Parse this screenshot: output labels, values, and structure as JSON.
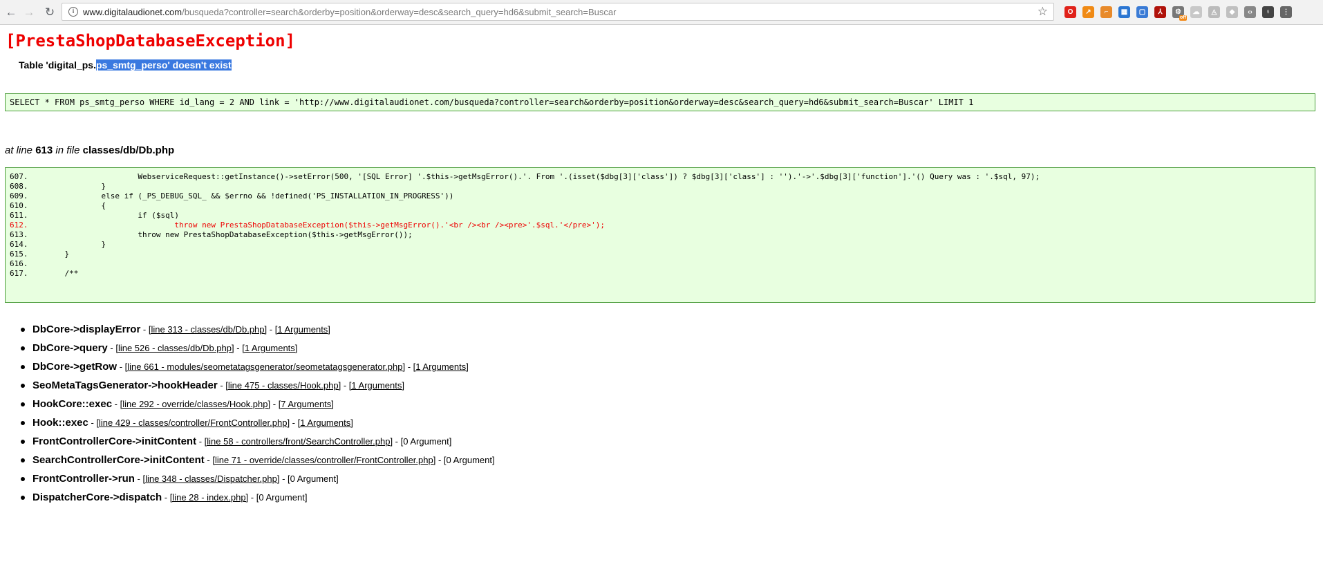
{
  "browser": {
    "url_host": "www.digitalaudionet.com",
    "url_path": "/busqueda?controller=search&orderby=position&orderway=desc&search_query=hd6&submit_search=Buscar",
    "back_icon": "arrow-left-icon",
    "forward_icon": "arrow-right-icon",
    "reload_icon": "reload-icon",
    "bookmark_icon": "star-icon",
    "extensions": [
      {
        "name": "opera-icon",
        "color": "#e0221a",
        "glyph": "O"
      },
      {
        "name": "chart-icon",
        "color": "#f08a14",
        "glyph": "↗"
      },
      {
        "name": "rss-icon",
        "color": "#e88a2a",
        "glyph": "⌐"
      },
      {
        "name": "calendar-icon",
        "color": "#2b76d2",
        "glyph": "▦"
      },
      {
        "name": "screen-icon",
        "color": "#3a7bd5",
        "glyph": "▢"
      },
      {
        "name": "pdf-icon",
        "color": "#b0120a",
        "glyph": "⅄"
      },
      {
        "name": "settings-off-icon",
        "color": "#777777",
        "glyph": "⚙",
        "badge": "off"
      },
      {
        "name": "cloud-icon",
        "color": "#c8c8c8",
        "glyph": "☁"
      },
      {
        "name": "drive-icon",
        "color": "#bbbbbb",
        "glyph": "◬"
      },
      {
        "name": "diamond-icon",
        "color": "#c0c0c0",
        "glyph": "◆"
      },
      {
        "name": "code-icon",
        "color": "#888888",
        "glyph": "‹›"
      },
      {
        "name": "lightbulb-icon",
        "color": "#444444",
        "glyph": "♀"
      },
      {
        "name": "menu-icon",
        "color": "#666666",
        "glyph": "⋮"
      }
    ]
  },
  "error": {
    "title": "[PrestaShopDatabaseException]",
    "message_prefix": "Table 'digital_ps.",
    "message_selected": "ps_smtg_perso' doesn't exist",
    "sql": "SELECT * FROM ps_smtg_perso WHERE id_lang = 2 AND link = 'http://www.digitalaudionet.com/busqueda?controller=search&orderby=position&orderway=desc&search_query=hd6&submit_search=Buscar' LIMIT 1",
    "at_line_prefix": "at line",
    "line": "613",
    "in_file_text": "in file",
    "file": "classes/db/Db.php"
  },
  "code": [
    {
      "num": "607.",
      "text": "                    WebserviceRequest::getInstance()->setError(500, '[SQL Error] '.$this->getMsgError().'. From '.(isset($dbg[3]['class']) ? $dbg[3]['class'] : '').'->'.$dbg[3]['function'].'() Query was : '.$sql, 97);",
      "highlight": false
    },
    {
      "num": "608.",
      "text": "            }",
      "highlight": false
    },
    {
      "num": "609.",
      "text": "            else if (_PS_DEBUG_SQL_ && $errno && !defined('PS_INSTALLATION_IN_PROGRESS'))",
      "highlight": false
    },
    {
      "num": "610.",
      "text": "            {",
      "highlight": false
    },
    {
      "num": "611.",
      "text": "                    if ($sql)",
      "highlight": false
    },
    {
      "num": "612.",
      "text": "                            throw new PrestaShopDatabaseException($this->getMsgError().'<br /><br /><pre>'.$sql.'</pre>');",
      "highlight": true
    },
    {
      "num": "613.",
      "text": "                    throw new PrestaShopDatabaseException($this->getMsgError());",
      "highlight": false
    },
    {
      "num": "614.",
      "text": "            }",
      "highlight": false
    },
    {
      "num": "615.",
      "text": "    }",
      "highlight": false
    },
    {
      "num": "616.",
      "text": "",
      "highlight": false
    },
    {
      "num": "617.",
      "text": "    /**",
      "highlight": false
    }
  ],
  "trace": [
    {
      "fn": "DbCore->displayError",
      "sep1": " - ",
      "loc": "[line 313 - classes/db/Db.php]",
      "sep2": " - ",
      "args": "[1 Arguments]",
      "args_link": true
    },
    {
      "fn": "DbCore->query",
      "sep1": " - ",
      "loc": "[line 526 - classes/db/Db.php]",
      "sep2": " - ",
      "args": "[1 Arguments]",
      "args_link": true
    },
    {
      "fn": "DbCore->getRow",
      "sep1": " - ",
      "loc": "[line 661 - modules/seometatagsgenerator/seometatagsgenerator.php]",
      "sep2": " - ",
      "args": "[1 Arguments]",
      "args_link": true
    },
    {
      "fn": "SeoMetaTagsGenerator->hookHeader",
      "sep1": " - ",
      "loc": "[line 475 - classes/Hook.php]",
      "sep2": " - ",
      "args": "[1 Arguments]",
      "args_link": true
    },
    {
      "fn": "HookCore::exec",
      "sep1": " - ",
      "loc": "[line 292 - override/classes/Hook.php]",
      "sep2": " - ",
      "args": "[7 Arguments]",
      "args_link": true
    },
    {
      "fn": "Hook::exec",
      "sep1": " - ",
      "loc": "[line 429 - classes/controller/FrontController.php]",
      "sep2": " - ",
      "args": "[1 Arguments]",
      "args_link": true
    },
    {
      "fn": "FrontControllerCore->initContent",
      "sep1": " - ",
      "loc": "[line 58 - controllers/front/SearchController.php]",
      "sep2": " - ",
      "args": "[0 Argument]",
      "args_link": false
    },
    {
      "fn": "SearchControllerCore->initContent",
      "sep1": " - ",
      "loc": "[line 71 - override/classes/controller/FrontController.php]",
      "sep2": " - ",
      "args": "[0 Argument]",
      "args_link": false
    },
    {
      "fn": "FrontController->run",
      "sep1": " - ",
      "loc": "[line 348 - classes/Dispatcher.php]",
      "sep2": " - ",
      "args": "[0 Argument]",
      "args_link": false
    },
    {
      "fn": "DispatcherCore->dispatch",
      "sep1": " - ",
      "loc": "[line 28 - index.php]",
      "sep2": " - ",
      "args": "[0 Argument]",
      "args_link": false
    }
  ]
}
